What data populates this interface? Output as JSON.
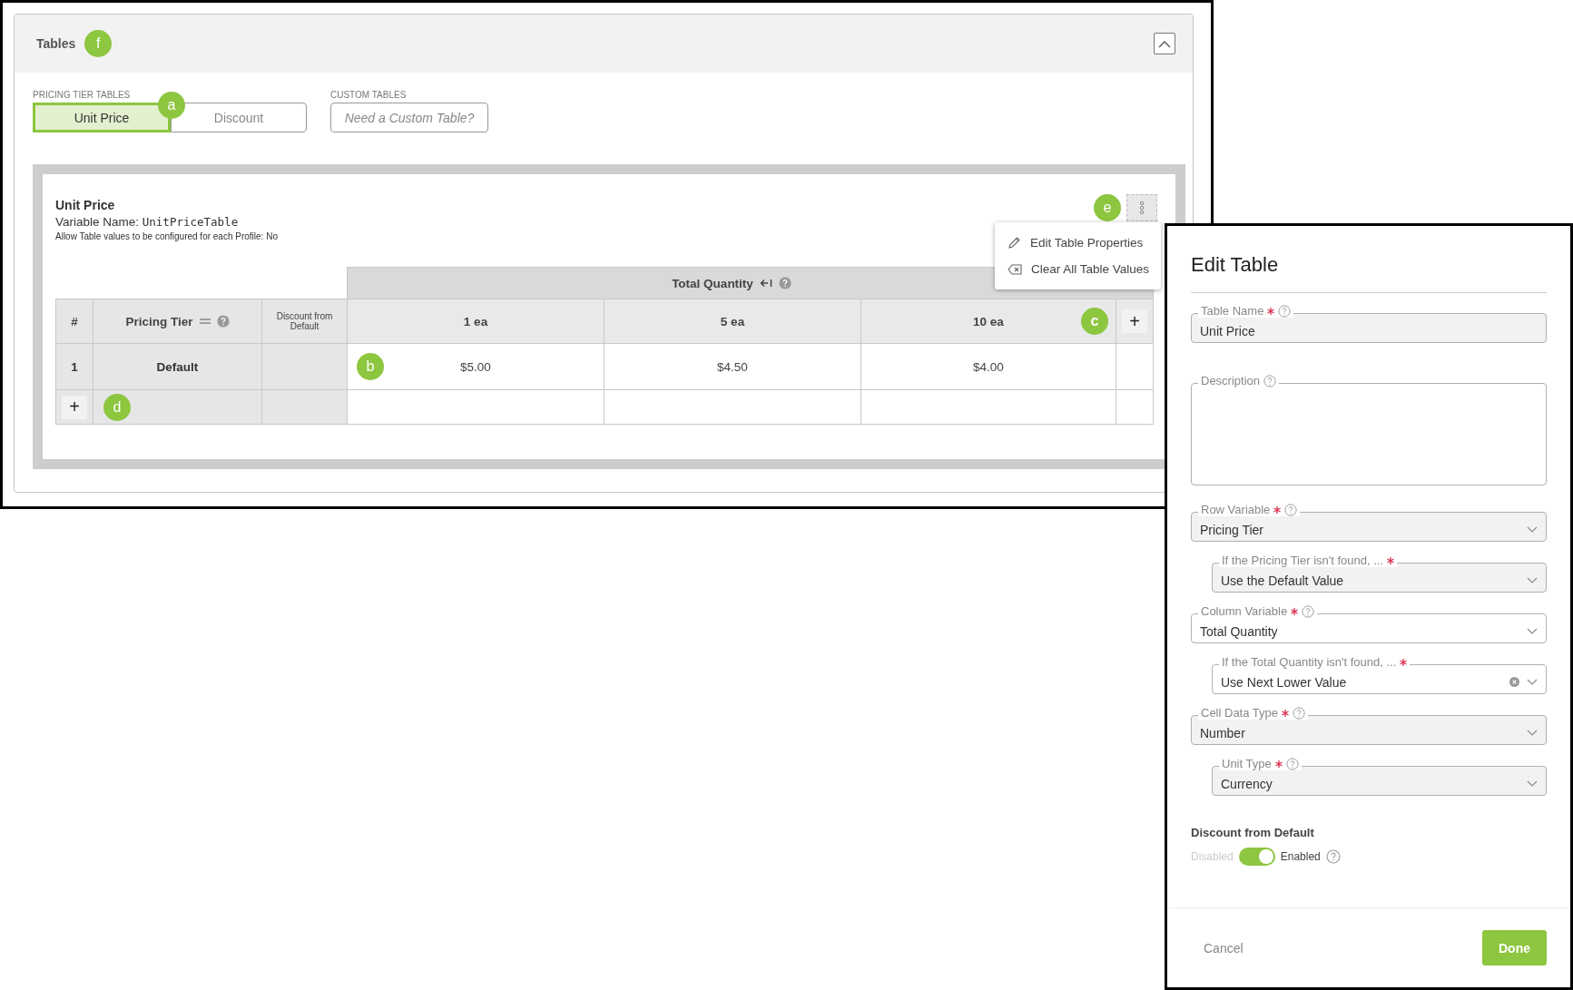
{
  "section": {
    "title": "Tables",
    "callout": "f"
  },
  "tab_groups": [
    {
      "label": "PRICING TIER TABLES",
      "tabs": [
        {
          "label": "Unit Price",
          "selected": true,
          "kind": "tab",
          "callout": "a"
        },
        {
          "label": "Discount",
          "selected": false,
          "kind": "tab"
        }
      ]
    },
    {
      "label": "CUSTOM TABLES",
      "tabs": [
        {
          "label": "Need a Custom Table?",
          "selected": false,
          "kind": "link"
        }
      ]
    }
  ],
  "table_card": {
    "title": "Unit Price",
    "variable_label": "Variable Name:",
    "variable_name": "UnitPriceTable",
    "profile_note": "Allow Table values to be configured for each Profile:  No",
    "menu_callout": "e",
    "menu": [
      {
        "label": "Edit Table Properties",
        "kind": "edit"
      },
      {
        "label": "Clear All Table Values",
        "kind": "clear"
      }
    ]
  },
  "table": {
    "group_header": "Total Quantity",
    "columns": [
      {
        "label": "#",
        "kind": "index"
      },
      {
        "label": "Pricing Tier",
        "kind": "variable"
      },
      {
        "label": "Discount from Default",
        "kind": "note"
      }
    ],
    "quantities": [
      {
        "label": "1  ea"
      },
      {
        "label": "5  ea"
      },
      {
        "label": "10  ea",
        "callout": "c"
      }
    ],
    "add_column_button": "+",
    "rows": [
      {
        "number": "1",
        "tier": "Default",
        "values": [
          {
            "text": "$5.00",
            "callout": "b"
          },
          {
            "text": "$4.50"
          },
          {
            "text": "$4.00"
          }
        ]
      }
    ],
    "add_row_button": "+",
    "add_row_callout": "d"
  },
  "panel": {
    "title": "Edit Table",
    "fields": [
      {
        "label": "Table Name",
        "required": true,
        "help": true,
        "kind": "text",
        "value": "Unit Price",
        "disabled": true
      },
      {
        "label": "Description",
        "required": false,
        "help": true,
        "kind": "textarea",
        "disabled": false
      },
      {
        "label": "Row Variable",
        "required": true,
        "help": true,
        "kind": "select",
        "value": "Pricing Tier",
        "disabled": true,
        "children": [
          {
            "label": "If the Pricing Tier isn't found, ...",
            "required": true,
            "help": false,
            "kind": "select",
            "value": "Use the Default Value",
            "disabled": true
          }
        ]
      },
      {
        "label": "Column Variable",
        "required": true,
        "help": true,
        "kind": "select",
        "value": "Total Quantity",
        "disabled": false,
        "children": [
          {
            "label": "If the Total Quantity isn't found, ...",
            "required": true,
            "help": false,
            "kind": "select",
            "value": "Use Next Lower Value",
            "disabled": false,
            "clearable": true
          }
        ]
      },
      {
        "label": "Cell Data Type",
        "required": true,
        "help": true,
        "kind": "select",
        "value": "Number",
        "disabled": true,
        "children": [
          {
            "label": "Unit Type",
            "required": true,
            "help": true,
            "kind": "select",
            "value": "Currency",
            "disabled": true
          }
        ]
      }
    ],
    "toggle": {
      "title": "Discount from Default",
      "off_label": "Disabled",
      "on_label": "Enabled",
      "on": true
    },
    "buttons": [
      {
        "label": "Cancel",
        "kind": "secondary"
      },
      {
        "label": "Done",
        "kind": "primary"
      }
    ]
  }
}
